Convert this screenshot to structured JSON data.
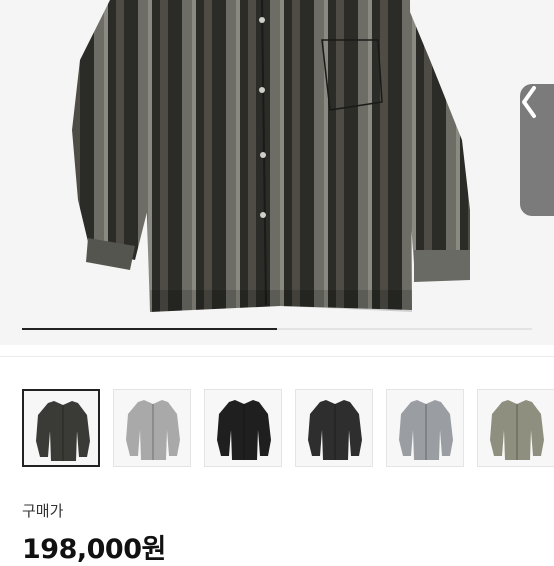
{
  "gallery": {
    "main_image_icon": "striped-shirt",
    "prev_button_icon": "chevron-left-icon",
    "progress_fraction": 0.5
  },
  "thumbnails": [
    {
      "label_icon": "striped-shirt-icon",
      "color": "#3a3a36",
      "active": true
    },
    {
      "label_icon": "gray-shirt-icon",
      "color": "#a9a9a9",
      "active": false
    },
    {
      "label_icon": "black-shirt-icon",
      "color": "#1f1f1f",
      "active": false
    },
    {
      "label_icon": "charcoal-shirt-icon",
      "color": "#2e2e2e",
      "active": false
    },
    {
      "label_icon": "gray-check-shirt-icon",
      "color": "#9a9ea3",
      "active": false
    },
    {
      "label_icon": "khaki-shirt-icon",
      "color": "#8f8f7f",
      "active": false
    }
  ],
  "pricing": {
    "label": "구매가",
    "price": "198,000원"
  }
}
